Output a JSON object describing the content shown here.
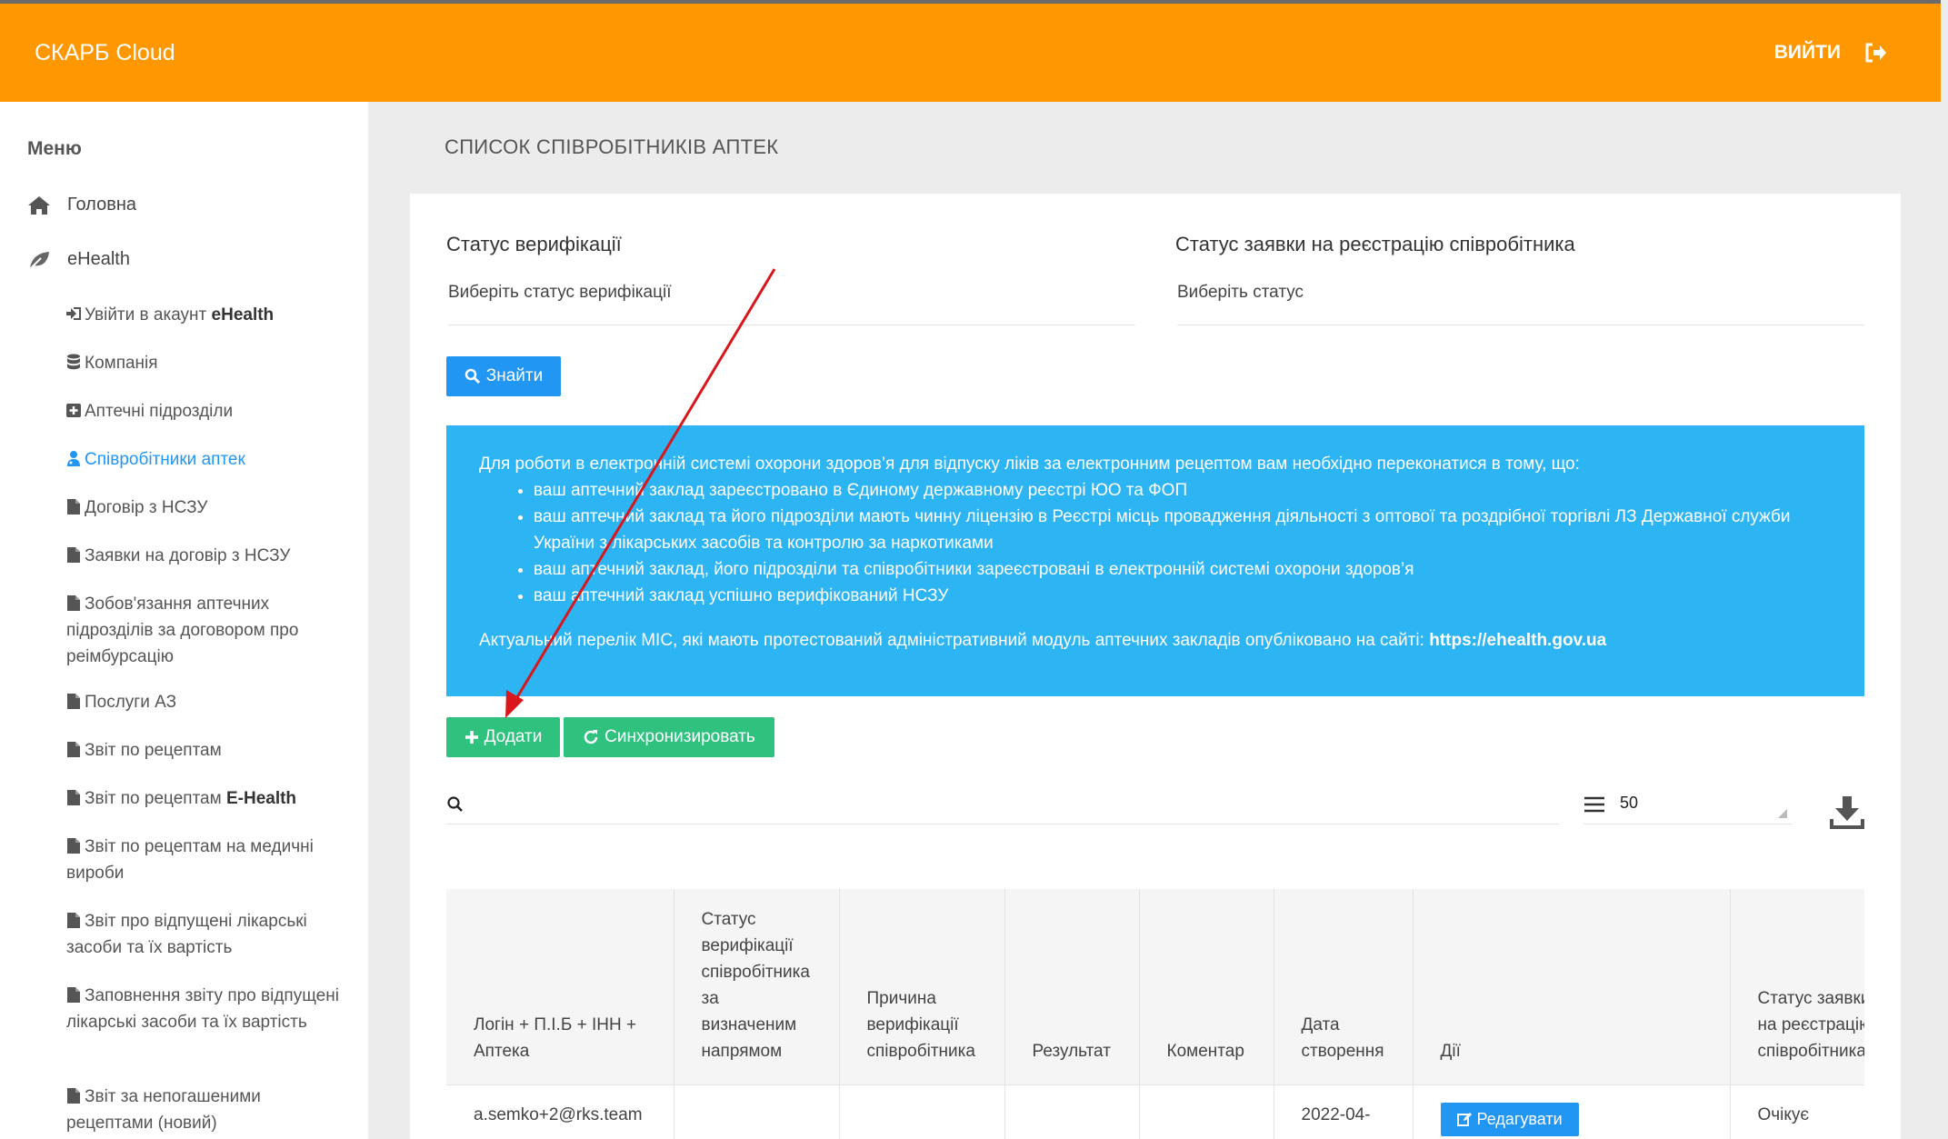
{
  "header": {
    "brand": "СКАРБ Cloud",
    "logout_label": "ВИЙТИ"
  },
  "sidebar": {
    "title": "Меню",
    "home": "Головна",
    "ehealth": "eHealth",
    "items": [
      {
        "label_prefix": "Увійти в акаунт ",
        "label_bold": "eHealth"
      },
      {
        "label": "Компанія"
      },
      {
        "label": "Аптечні підрозділи"
      },
      {
        "label": "Співробітники аптек"
      },
      {
        "label": "Договір з НСЗУ"
      },
      {
        "label": "Заявки на договір з НСЗУ"
      },
      {
        "label": "Зобов'язання аптечних підрозділів за договором про реімбурсацію"
      },
      {
        "label": "Послуги АЗ"
      },
      {
        "label": "Звіт по рецептам"
      },
      {
        "label_prefix": "Звіт по рецептам ",
        "label_bold": "E-Health"
      },
      {
        "label": "Звіт по рецептам на медичні вироби"
      },
      {
        "label": "Звіт про відпущені лікарські засоби та їх вартість"
      },
      {
        "label": "Заповнення звіту про відпущені лікарські засоби та їх вартість"
      },
      {
        "label": "Звіт за непогашеними рецептами (новий)"
      }
    ]
  },
  "page": {
    "title": "СПИСОК СПІВРОБІТНИКІВ АПТЕК"
  },
  "filters": {
    "verification_label": "Статус верифікації",
    "verification_value": "Виберіть статус верифікації",
    "request_label": "Статус заявки на реєстрацію співробітника",
    "request_value": "Виберіть статус"
  },
  "buttons": {
    "find": "Знайти",
    "add": "Додати",
    "sync": "Синхронизировать",
    "edit": "Редагувати"
  },
  "info": {
    "intro": "Для роботи в електронній системі охорони здоров’я для відпуску ліків за електронним рецептом вам необхідно переконатися в тому, що:",
    "bullets": [
      "ваш аптечний заклад зареєстровано в Єдиному державному реєстрі ЮО та ФОП",
      "ваш аптечний заклад та його підрозділи мають чинну ліцензію в Реєстрі місць провадження діяльності з оптової та роздрібної торгівлі ЛЗ Державної служби України з лікарських засобів та контролю за наркотиками",
      "ваш аптечний заклад, його підрозділи та співробітники зареєстровані в електронній системі охорони здоров’я",
      "ваш аптечний заклад успішно верифікований НСЗУ"
    ],
    "footer": "Актуальний перелік МІС, які мають протестований адміністративний модуль аптечних закладів опубліковано на сайті: ",
    "link": "https://ehealth.gov.ua"
  },
  "table": {
    "page_size": "50",
    "columns": [
      "Логін + П.І.Б + ІНН + Аптека",
      "Статус верифікації співробітника за визначеним напрямом",
      "Причина верифікації співробітника",
      "Результат",
      "Коментар",
      "Дата створення",
      "Дії",
      "Статус заявки на реєстрацію співробітника"
    ],
    "rows": [
      {
        "login": "a.semko+2@rks.team",
        "date": "2022-04-",
        "status": "Очікує"
      }
    ]
  },
  "colors": {
    "header": "#ff9800",
    "primary": "#2196f3",
    "success": "#2ec27e",
    "info": "#2db4f2",
    "annotation": "#d9161c"
  }
}
